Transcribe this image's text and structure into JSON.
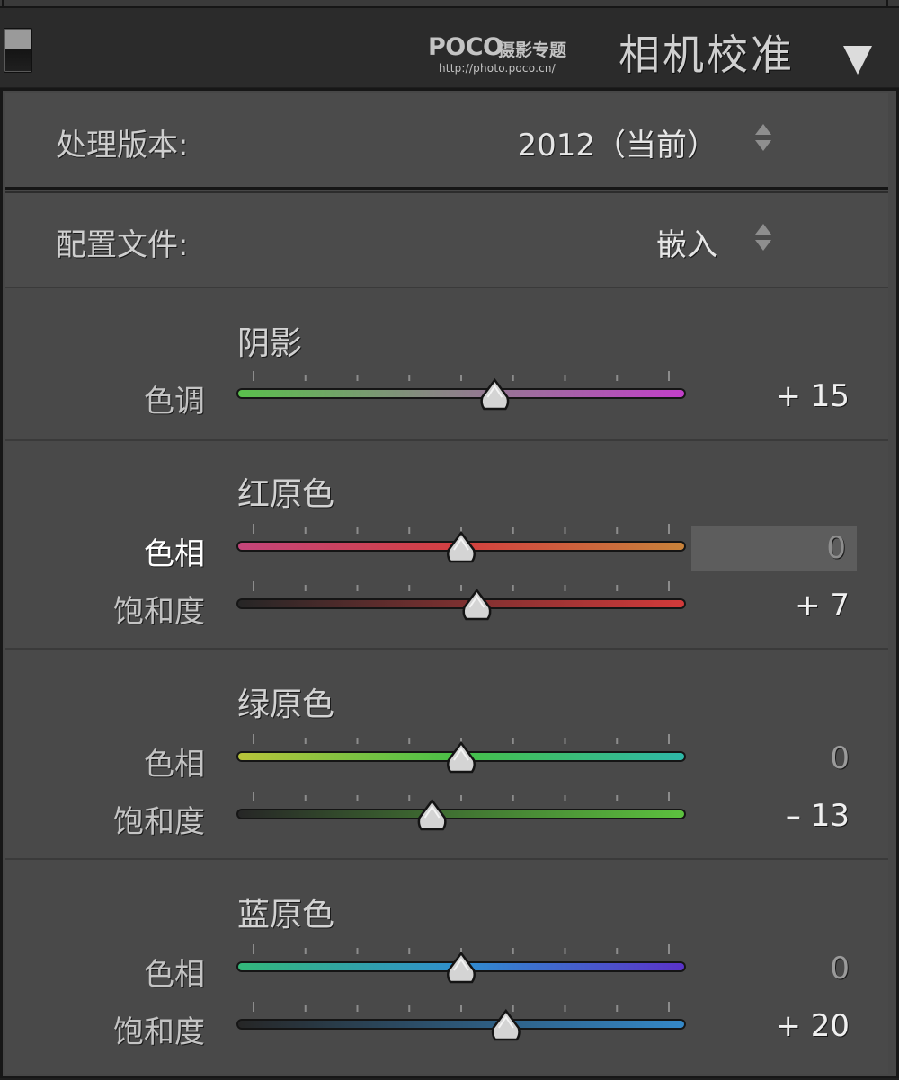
{
  "header": {
    "logo_word": "POCO",
    "logo_cn": "摄影专题",
    "logo_url": "http://photo.poco.cn/",
    "title": "相机校准",
    "collapse_icon": "triangle-down-icon"
  },
  "process": {
    "label": "处理版本:",
    "value": "2012（当前）"
  },
  "profile": {
    "label": "配置文件:",
    "value": "嵌入"
  },
  "groups": [
    {
      "title": "阴影",
      "sliders": [
        {
          "label": "色调",
          "value": "+ 15",
          "position": 0.575,
          "colors": [
            "#5ac04c",
            "#c23fc9"
          ]
        }
      ]
    },
    {
      "title": "红原色",
      "sliders": [
        {
          "label": "色相",
          "value": "0",
          "position": 0.5,
          "colors": [
            "#c4457a",
            "#d33f3f",
            "#c8823a"
          ]
        },
        {
          "label": "饱和度",
          "value": "+ 7",
          "position": 0.535,
          "colors": [
            "#262626",
            "#d23a3a"
          ]
        }
      ]
    },
    {
      "title": "绿原色",
      "sliders": [
        {
          "label": "色相",
          "value": "0",
          "position": 0.5,
          "colors": [
            "#b8c43a",
            "#46c048",
            "#2eb8a8"
          ]
        },
        {
          "label": "饱和度",
          "value": "– 13",
          "position": 0.435,
          "colors": [
            "#262626",
            "#5cc23e"
          ]
        }
      ]
    },
    {
      "title": "蓝原色",
      "sliders": [
        {
          "label": "色相",
          "value": "0",
          "position": 0.5,
          "colors": [
            "#33b87a",
            "#2f8ed0",
            "#5a32c8"
          ]
        },
        {
          "label": "饱和度",
          "value": "+ 20",
          "position": 0.6,
          "colors": [
            "#262626",
            "#3488c8"
          ]
        }
      ]
    }
  ],
  "colors": {
    "panel_bg": "#474747",
    "header_bg": "#2b2b2b",
    "text": "#cfcfcf",
    "focused_field": "#5d5d5d"
  }
}
